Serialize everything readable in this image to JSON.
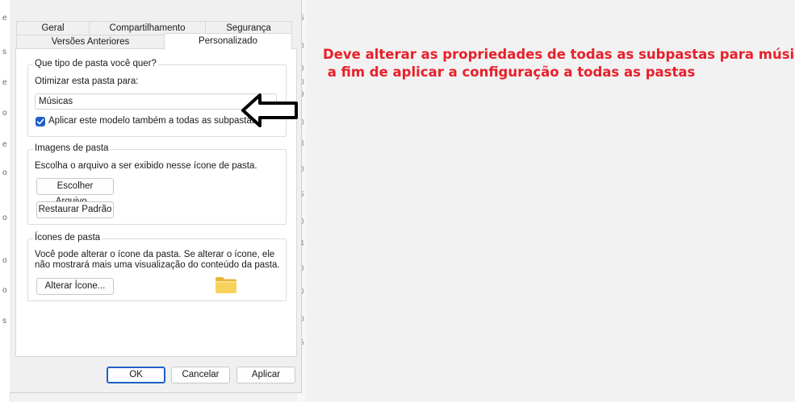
{
  "tabs_row1": [
    {
      "label": "Geral"
    },
    {
      "label": "Compartilhamento"
    },
    {
      "label": "Segurança"
    }
  ],
  "tabs_row2": [
    {
      "label": "Versões Anteriores"
    },
    {
      "label": "Personalizado",
      "active": true
    }
  ],
  "folder_type": {
    "title": "Que tipo de pasta você quer?",
    "optimize_label": "Otimizar esta pasta para:",
    "selected_value": "Músicas",
    "apply_subfolders_label": "Aplicar este modelo também a todas as subpastas",
    "apply_subfolders_checked": true
  },
  "folder_images": {
    "title": "Imagens de pasta",
    "description": "Escolha o arquivo a ser exibido nesse ícone de pasta.",
    "choose_file_button": "Escolher Arquivo...",
    "restore_default_button": "Restaurar Padrão"
  },
  "folder_icons": {
    "title": "Ícones de pasta",
    "description_line1": "Você pode alterar o  ícone da pasta. Se alterar o  ícone, ele",
    "description_line2": "não mostrará mais uma visualização do conteúdo da pasta.",
    "change_icon_button": "Alterar Ícone..."
  },
  "footer": {
    "ok": "OK",
    "cancel": "Cancelar",
    "apply": "Aplicar"
  },
  "annotation": {
    "line1": "Deve alterar as propriedades de todas as subpastas para música,",
    "line2": " a fim de aplicar a configuração a todas as pastas",
    "color": "#e8202a"
  },
  "colors": {
    "accent": "#1e60c8",
    "dialog_bg": "#f0f0f0",
    "panel_bg": "#ffffff"
  },
  "background_fragments": {
    "left": [
      "e",
      "s",
      "e",
      "o",
      "e",
      "o",
      "o",
      "o",
      "o",
      "s"
    ],
    "right": [
      "5",
      "0",
      "0",
      "0",
      "9",
      "0",
      "8",
      "0",
      "5",
      "0",
      "4",
      "0",
      "0",
      "0",
      "5"
    ]
  }
}
